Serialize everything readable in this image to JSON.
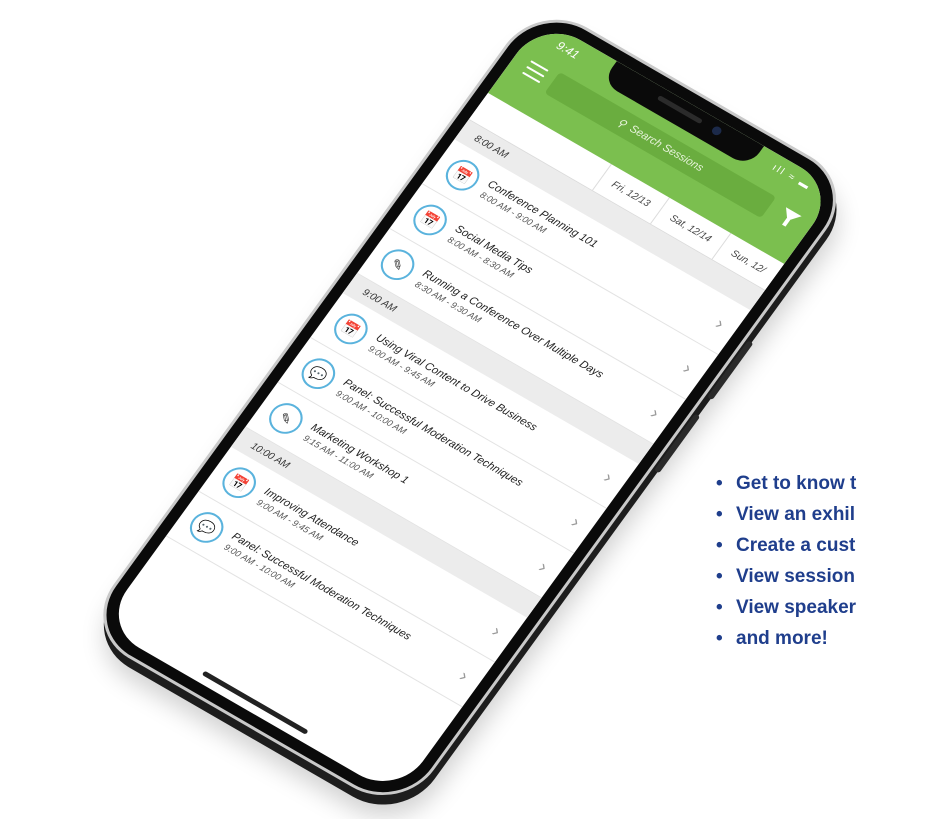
{
  "status": {
    "time": "9:41",
    "icons": "ıll ≈ ▬"
  },
  "header": {
    "search_placeholder": "Search Sessions"
  },
  "dates": [
    "Fri, 12/13",
    "Sat, 12/14",
    "Sun, 12/"
  ],
  "blocks": [
    {
      "time": "8:00 AM",
      "sessions": [
        {
          "icon": "calendar-icon",
          "title": "Conference Planning 101",
          "time": "8:00 AM - 9:00 AM"
        },
        {
          "icon": "calendar-icon",
          "title": "Social Media Tips",
          "time": "8:00 AM - 8:30 AM"
        },
        {
          "icon": "edit-icon",
          "title": "Running a Conference Over Multiple Days",
          "time": "8:30 AM - 9:30 AM"
        }
      ]
    },
    {
      "time": "9:00 AM",
      "sessions": [
        {
          "icon": "calendar-icon",
          "title": "Using Viral Content to Drive Business",
          "time": "9:00 AM - 9:45 AM"
        },
        {
          "icon": "chat-icon",
          "title": "Panel: Successful Moderation Techniques",
          "time": "9:00 AM - 10:00 AM"
        },
        {
          "icon": "edit-icon",
          "title": "Marketing Workshop 1",
          "time": "9:15 AM - 11:00 AM"
        }
      ]
    },
    {
      "time": "10:00 AM",
      "sessions": [
        {
          "icon": "calendar-icon",
          "title": "Improving Attendance",
          "time": "9:00 AM - 9:45 AM"
        },
        {
          "icon": "chat-icon",
          "title": "Panel: Successful Moderation Techniques",
          "time": "9:00 AM - 10:00 AM"
        }
      ]
    }
  ],
  "features": [
    "Get to know t",
    "View an exhil",
    "Create a cust",
    "View session",
    "View speaker",
    "and more!"
  ],
  "colors": {
    "header_green": "#7bbf4f",
    "icon_blue": "#5ab3dd",
    "feature_blue": "#1f3e8c"
  }
}
